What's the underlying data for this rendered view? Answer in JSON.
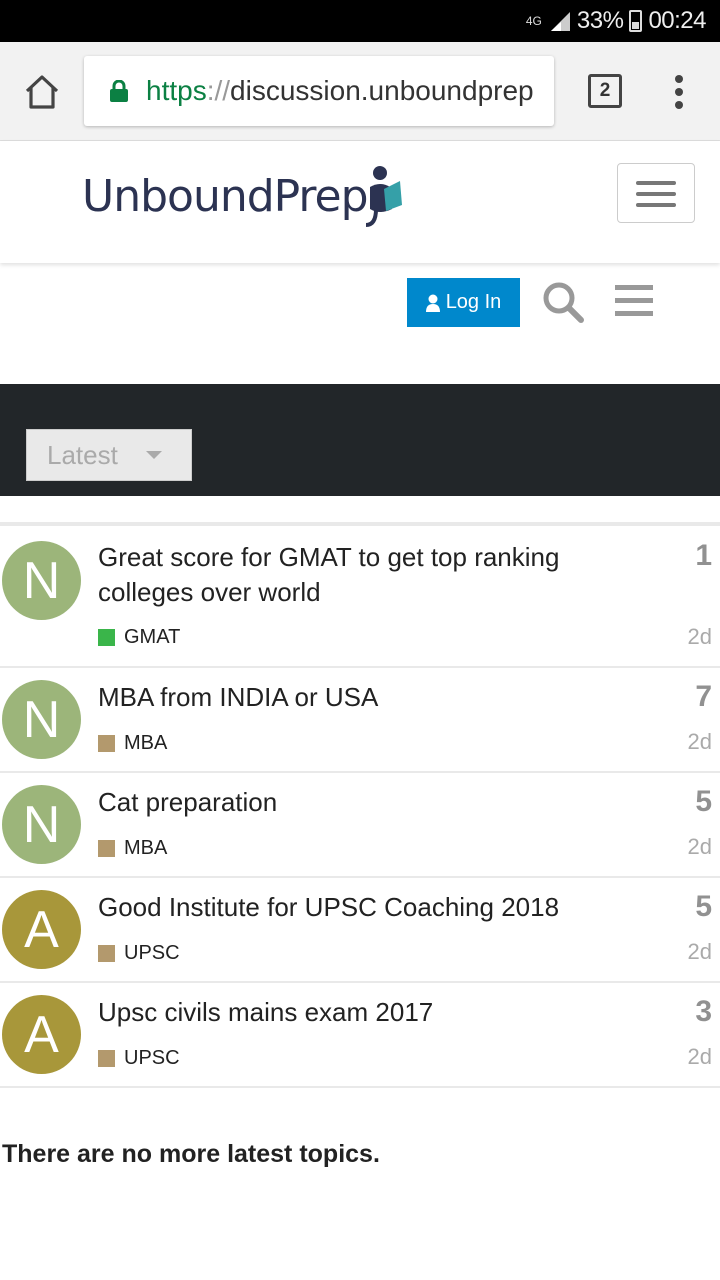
{
  "status_bar": {
    "network": "4G",
    "battery": "33%",
    "time": "00:24"
  },
  "browser": {
    "url_scheme": "https",
    "url_sep": "://",
    "url_host": "discussion.unboundprep",
    "tab_count": "2"
  },
  "site": {
    "logo_text": "UnboundPrep",
    "login_label": "Log In",
    "filter_label": "Latest"
  },
  "colors": {
    "accent": "#0088cc",
    "header_dark": "#222629",
    "gmat": "#3ab54a",
    "mba": "#b3996d",
    "upsc": "#b3996d",
    "avatar_n": "#9cb57a",
    "avatar_a": "#a8973a"
  },
  "topics": [
    {
      "avatar": "N",
      "title": "Great score for GMAT to get top ranking colleges over world",
      "category": "GMAT",
      "replies": "1",
      "age": "2d"
    },
    {
      "avatar": "N",
      "title": "MBA from INDIA or USA",
      "category": "MBA",
      "replies": "7",
      "age": "2d"
    },
    {
      "avatar": "N",
      "title": "Cat preparation",
      "category": "MBA",
      "replies": "5",
      "age": "2d"
    },
    {
      "avatar": "A",
      "title": "Good Institute for UPSC Coaching 2018",
      "category": "UPSC",
      "replies": "5",
      "age": "2d"
    },
    {
      "avatar": "A",
      "title": "Upsc civils mains exam 2017",
      "category": "UPSC",
      "replies": "3",
      "age": "2d"
    }
  ],
  "footer": {
    "message": "There are no more latest topics."
  }
}
